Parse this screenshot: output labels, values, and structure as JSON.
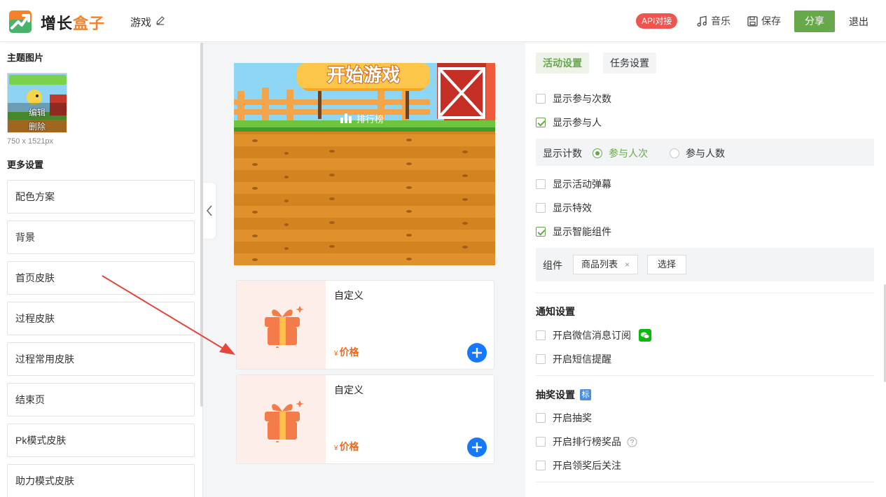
{
  "header": {
    "brand_main": "增长",
    "brand_highlight": "盒子",
    "page_name": "游戏",
    "api_badge": "API对接",
    "music": "音乐",
    "save": "保存",
    "share": "分享",
    "exit": "退出"
  },
  "left": {
    "theme_title": "主题图片",
    "thumb_edit": "编辑",
    "thumb_delete": "删除",
    "thumb_size": "750 x 1521px",
    "more_title": "更多设置",
    "items": [
      "配色方案",
      "背景",
      "首页皮肤",
      "过程皮肤",
      "过程常用皮肤",
      "结束页",
      "Pk模式皮肤",
      "助力模式皮肤"
    ]
  },
  "preview": {
    "start_game": "开始游戏",
    "leaderboard": "排行榜",
    "products": [
      {
        "name": "自定义",
        "currency": "¥",
        "price": "价格"
      },
      {
        "name": "自定义",
        "currency": "¥",
        "price": "价格"
      }
    ]
  },
  "right": {
    "tabs": [
      "活动设置",
      "任务设置"
    ],
    "show_join_times": "显示参与次数",
    "show_participants": "显示参与人",
    "count_label": "显示计数",
    "count_options": [
      "参与人次",
      "参与人数"
    ],
    "show_barrage": "显示活动弹幕",
    "show_effects": "显示特效",
    "show_smart": "显示智能组件",
    "component_label": "组件",
    "component_tag": "商品列表",
    "tag_close": "×",
    "select_btn": "选择",
    "notify_title": "通知设置",
    "notify_wechat": "开启微信消息订阅",
    "notify_sms": "开启短信提醒",
    "lottery_title": "抽奖设置",
    "lottery_badge": "标",
    "lottery_enable": "开启抽奖",
    "lottery_rank": "开启排行榜奖品",
    "lottery_follow": "开启领奖后关注"
  },
  "colors": {
    "accent_green": "#67a84a",
    "api_red": "#f0544f",
    "brand_orange": "#f5822a",
    "add_blue": "#1677ff",
    "annotation_red": "#e8453c"
  }
}
